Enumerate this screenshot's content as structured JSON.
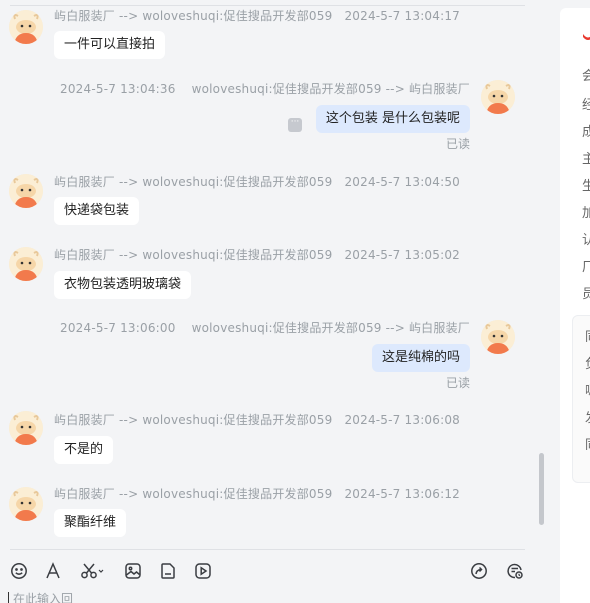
{
  "messages": [
    {
      "direction": "in",
      "sender": "屿白服装厂 --> woloveshuqi:促佳搜品开发部059",
      "time": "2024-5-7 13:04:17",
      "text": "一件可以直接拍"
    },
    {
      "direction": "out",
      "sender": "woloveshuqi:促佳搜品开发部059 --> 屿白服装厂",
      "time": "2024-5-7 13:04:36",
      "text": "这个包装  是什么包装呢",
      "status": "已读",
      "more_icon": "more-icon"
    },
    {
      "direction": "in",
      "sender": "屿白服装厂 --> woloveshuqi:促佳搜品开发部059",
      "time": "2024-5-7 13:04:50",
      "text": "快递袋包装"
    },
    {
      "direction": "in",
      "sender": "屿白服装厂 --> woloveshuqi:促佳搜品开发部059",
      "time": "2024-5-7 13:05:02",
      "text": "衣物包装透明玻璃袋"
    },
    {
      "direction": "out",
      "sender": "woloveshuqi:促佳搜品开发部059 --> 屿白服装厂",
      "time": "2024-5-7 13:06:00",
      "text": "这是纯棉的吗",
      "status": "已读"
    },
    {
      "direction": "in",
      "sender": "屿白服装厂 --> woloveshuqi:促佳搜品开发部059",
      "time": "2024-5-7 13:06:08",
      "text": "不是的"
    },
    {
      "direction": "in",
      "sender": "屿白服装厂 --> woloveshuqi:促佳搜品开发部059",
      "time": "2024-5-7 13:06:12",
      "text": "聚酯纤维"
    }
  ],
  "toolbar": {
    "left_icons": [
      "emoji-icon",
      "font-icon",
      "scissors-icon",
      "image-icon",
      "file-icon",
      "video-icon"
    ],
    "right_icons": [
      "share-icon",
      "history-icon"
    ]
  },
  "input": {
    "placeholder": "在此输入回"
  },
  "right_panel": {
    "items": [
      "会",
      "经",
      "成",
      "主",
      "生",
      "加",
      "认",
      "厂",
      "员"
    ],
    "box_items": [
      "同",
      "负",
      "嗯",
      "发",
      "同"
    ],
    "accent": "#e8392f"
  },
  "colors": {
    "bubble_out": "#dde9fd",
    "bubble_in": "#ffffff",
    "meta": "#9aa0a6"
  }
}
